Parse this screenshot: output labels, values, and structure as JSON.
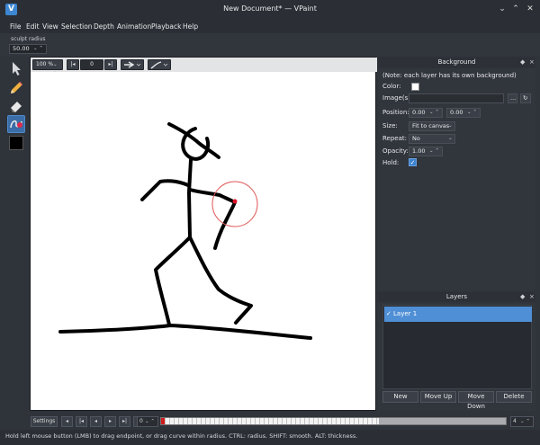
{
  "window": {
    "title": "New Document* — VPaint",
    "app_icon_letter": "V"
  },
  "menu": [
    "File",
    "Edit",
    "View",
    "Selection",
    "Depth",
    "Animation",
    "Playback",
    "Help"
  ],
  "tool_options": {
    "label": "sculpt radius",
    "value": "50.00"
  },
  "viewport_toolbar": {
    "zoom": "100 %",
    "frame": "0"
  },
  "background_panel": {
    "title": "Background",
    "note": "(Note: each layer has its own background)",
    "color_label": "Color:",
    "images_label": "Image(s):",
    "images_value": "",
    "browse_label": "...",
    "position_label": "Position:",
    "position_x": "0.00",
    "position_y": "0.00",
    "size_label": "Size:",
    "size_value": "Fit to canvas",
    "repeat_label": "Repeat:",
    "repeat_value": "No",
    "opacity_label": "Opacity:",
    "opacity_value": "1.00",
    "hold_label": "Hold:",
    "hold_checked": true
  },
  "layers_panel": {
    "title": "Layers",
    "layers": [
      {
        "name": "Layer 1",
        "visible": true,
        "selected": true
      }
    ],
    "buttons": {
      "new": "New",
      "move_up": "Move Up",
      "move_down": "Move Down",
      "delete": "Delete"
    }
  },
  "timeline": {
    "settings_label": "Settings",
    "current_frame": "0",
    "fps_value": "4"
  },
  "status": "Hold left mouse button (LMB) to drag endpoint, or drag curve within radius. CTRL: radius. SHIFT: smooth. ALT: thickness.",
  "colors": {
    "accent": "#4f8fd6",
    "brush_circle": "#e05555",
    "selected_vertex": "#e0102a",
    "stroke": "#000000"
  }
}
